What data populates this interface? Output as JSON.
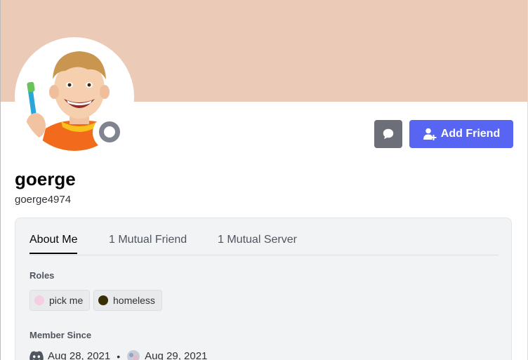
{
  "colors": {
    "banner": "#ebcbb8",
    "accent": "#5865f2",
    "secondary_button": "#6d6f78",
    "status_offline": "#80848e",
    "role_pick_me": "#f4cfe2",
    "role_homeless": "#3a2e05",
    "card_bg": "#f2f3f5"
  },
  "profile": {
    "display_name": "goerge",
    "username": "goerge4974",
    "status": "offline"
  },
  "actions": {
    "message_icon": "chat-bubble-icon",
    "add_friend_icon": "add-user-icon",
    "add_friend_label": "Add Friend"
  },
  "tabs": [
    {
      "label": "About Me",
      "active": true
    },
    {
      "label": "1 Mutual Friend",
      "active": false
    },
    {
      "label": "1 Mutual Server",
      "active": false
    }
  ],
  "roles": {
    "heading": "Roles",
    "items": [
      {
        "label": "pick me",
        "color": "#f4cfe2"
      },
      {
        "label": "homeless",
        "color": "#3a2e05"
      }
    ]
  },
  "member_since": {
    "heading": "Member Since",
    "discord_date": "Aug 28, 2021",
    "server_date": "Aug 29, 2021",
    "separator": "•"
  }
}
